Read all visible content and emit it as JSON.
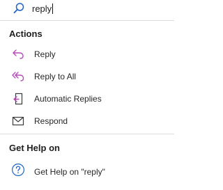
{
  "search": {
    "value": "reply",
    "icon": "search-icon"
  },
  "sections": {
    "actions": {
      "title": "Actions",
      "items": [
        {
          "label": "Reply",
          "icon": "reply-icon"
        },
        {
          "label": "Reply to All",
          "icon": "reply-all-icon"
        },
        {
          "label": "Automatic Replies",
          "icon": "automatic-replies-icon"
        },
        {
          "label": "Respond",
          "icon": "envelope-icon"
        }
      ]
    },
    "help": {
      "title": "Get Help on",
      "items": [
        {
          "label": "Get Help on \"reply\"",
          "icon": "help-icon"
        }
      ]
    }
  },
  "colors": {
    "accent": "#1e63c9",
    "reply_purple": "#b44ab7",
    "dark_icon": "#3a3a3a",
    "divider": "#dcdcdc"
  }
}
